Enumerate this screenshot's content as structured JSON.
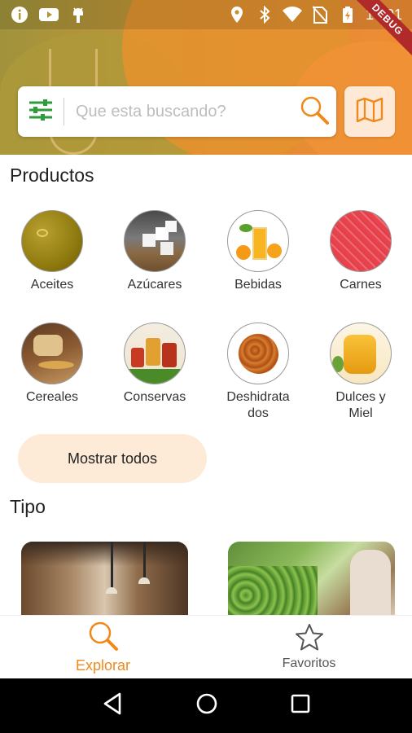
{
  "status_bar": {
    "time": "10:01",
    "debug_label": "DEBUG"
  },
  "search": {
    "placeholder": "Que esta buscando?"
  },
  "productos": {
    "title": "Productos",
    "categories": [
      {
        "label": "Aceites"
      },
      {
        "label": "Azúcares"
      },
      {
        "label": "Bebidas"
      },
      {
        "label": "Carnes"
      },
      {
        "label": "Cereales"
      },
      {
        "label": "Conservas"
      },
      {
        "label": "Deshidrata\ndos"
      },
      {
        "label": "Dulces y\nMiel"
      }
    ],
    "show_all": "Mostrar todos"
  },
  "tipo": {
    "title": "Tipo"
  },
  "bottom_nav": {
    "explore": "Explorar",
    "favorites": "Favoritos",
    "active_color": "#f0891a",
    "inactive_color": "#555555"
  },
  "colors": {
    "accent": "#f0891a",
    "chip_bg": "#fdebd8",
    "filter_green": "#2e9b3c"
  }
}
